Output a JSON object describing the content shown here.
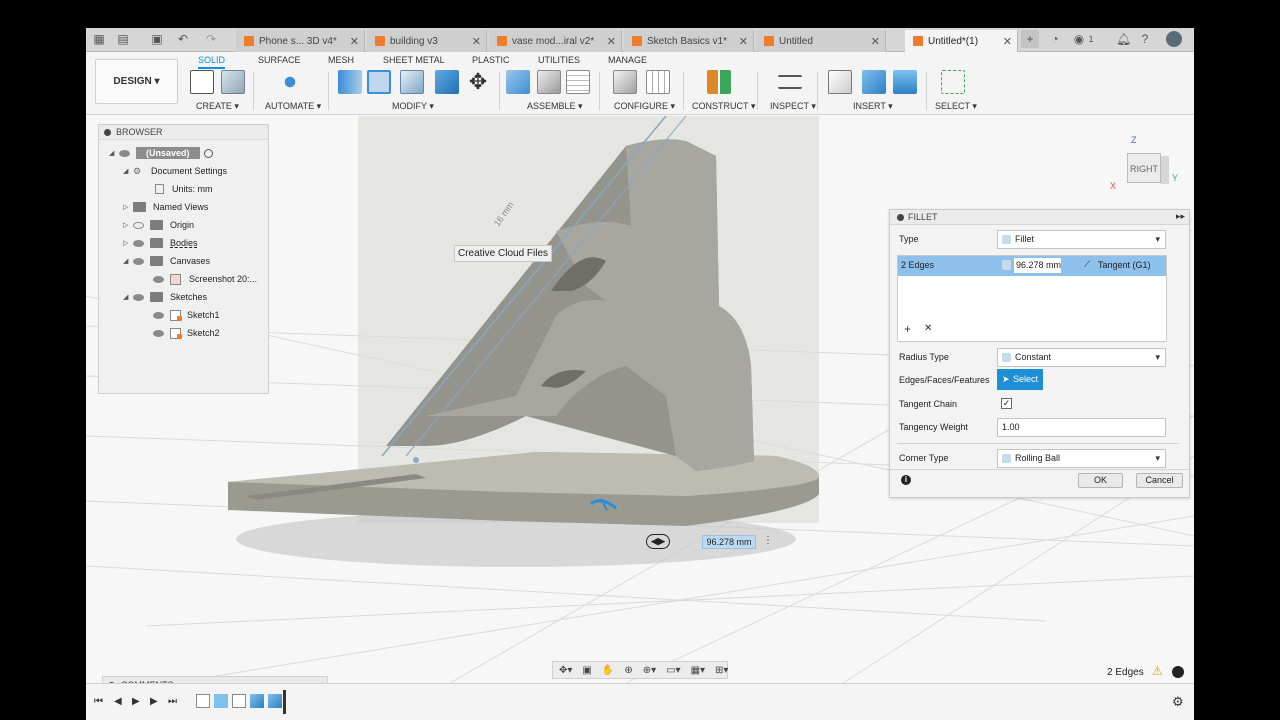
{
  "tabs": [
    {
      "label": "Phone s... 3D v4*",
      "active": false
    },
    {
      "label": "building v3",
      "active": false
    },
    {
      "label": "vase mod...iral v2*",
      "active": false
    },
    {
      "label": "Sketch Basics v1*",
      "active": false
    },
    {
      "label": "Untitled",
      "active": false
    },
    {
      "label": "Untitled*(1)",
      "active": true
    }
  ],
  "topright": {
    "notif_count": "1"
  },
  "toolbar": {
    "design_label": "DESIGN ▾",
    "workspace_tabs": [
      "SOLID",
      "SURFACE",
      "MESH",
      "SHEET METAL",
      "PLASTIC",
      "UTILITIES",
      "MANAGE"
    ],
    "groups": [
      "CREATE ▾",
      "AUTOMATE ▾",
      "MODIFY ▾",
      "ASSEMBLE ▾",
      "CONFIGURE ▾",
      "CONSTRUCT ▾",
      "INSPECT ▾",
      "INSERT ▾",
      "SELECT ▾"
    ]
  },
  "browser": {
    "title": "BROWSER",
    "rows": [
      {
        "label": "(Unsaved)"
      },
      {
        "label": "Document Settings"
      },
      {
        "label": "Units: mm"
      },
      {
        "label": "Named Views"
      },
      {
        "label": "Origin"
      },
      {
        "label": "Bodies"
      },
      {
        "label": "Canvases"
      },
      {
        "label": "Screenshot 20:..."
      },
      {
        "label": "Sketches"
      },
      {
        "label": "Sketch1"
      },
      {
        "label": "Sketch2"
      }
    ]
  },
  "viewport": {
    "tooltip": "Creative Cloud Files",
    "sketch_dim": "16 mm",
    "dimension_value": "96.278 mm"
  },
  "viewcube": {
    "face": "RIGHT",
    "z": "Z",
    "x": "X",
    "y": "Y"
  },
  "fillet": {
    "title": "FILLET",
    "type_label": "Type",
    "type_value": "Fillet",
    "selection_label": "2 Edges",
    "selection_radius": "96.278 mm",
    "selection_continuity": "Tangent (G1)",
    "add_symbol": "+",
    "remove_symbol": "✕",
    "radius_type_label": "Radius Type",
    "radius_type_value": "Constant",
    "edges_label": "Edges/Faces/Features",
    "select_btn": "Select",
    "tangent_chain_label": "Tangent Chain",
    "tangency_weight_label": "Tangency Weight",
    "tangency_weight_value": "1.00",
    "corner_type_label": "Corner Type",
    "corner_type_value": "Rolling Ball",
    "ok": "OK",
    "cancel": "Cancel"
  },
  "comments": {
    "label": "COMMENTS"
  },
  "status": {
    "selection": "2 Edges"
  }
}
